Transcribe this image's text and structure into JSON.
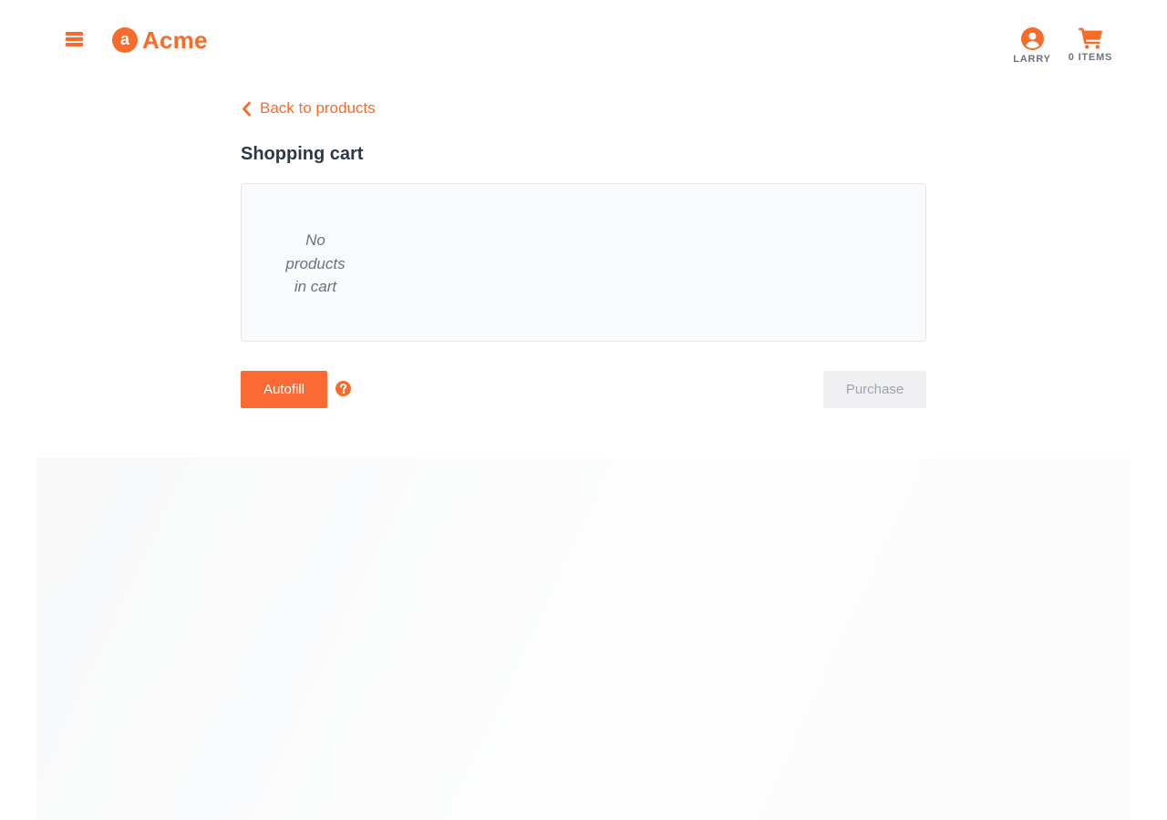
{
  "header": {
    "brand_letter": "a",
    "brand_name": "Acme",
    "user_label": "LARRY",
    "cart_label": "0 ITEMS"
  },
  "main": {
    "back_link": "Back to products",
    "title": "Shopping cart",
    "empty_message": "No products in cart"
  },
  "actions": {
    "autofill_label": "Autofill",
    "purchase_label": "Purchase"
  },
  "icons": {
    "menu": "hamburger-menu-icon",
    "user": "user-circle-icon",
    "cart": "shopping-cart-icon",
    "back": "chevron-left-icon",
    "help": "question-circle-icon"
  },
  "colors": {
    "accent": "#f76b2b",
    "title_text": "#2d3748",
    "muted_text": "#6b7280",
    "panel_background": "#f9fafb",
    "disabled_button": "#f0f0f2"
  }
}
